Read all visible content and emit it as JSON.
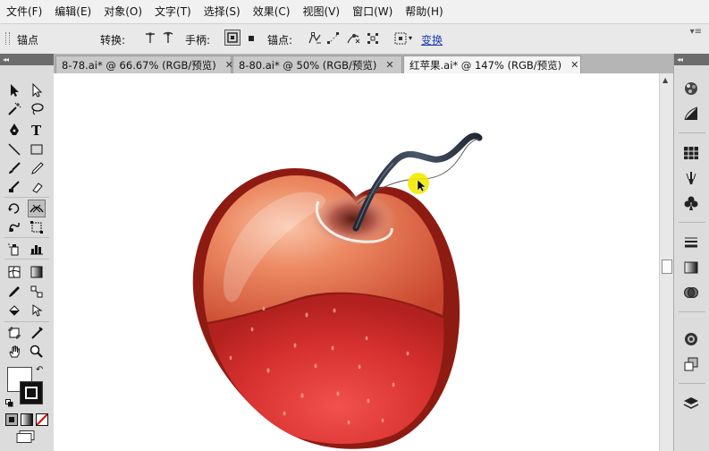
{
  "menu": [
    "文件(F)",
    "编辑(E)",
    "对象(O)",
    "文字(T)",
    "选择(S)",
    "效果(C)",
    "视图(V)",
    "窗口(W)",
    "帮助(H)"
  ],
  "control_bar": {
    "mode_label": "锚点",
    "convert_label": "转换:",
    "handles_label": "手柄:",
    "anchors_label": "锚点:",
    "transform_link": "变换"
  },
  "tabs": [
    {
      "label": "8-78.ai* @ 66.67% (RGB/预览)",
      "active": false
    },
    {
      "label": "8-80.ai* @ 50% (RGB/预览)",
      "active": false
    },
    {
      "label": "红苹果.ai* @ 147% (RGB/预览)",
      "active": true
    }
  ],
  "colors": {
    "apple_dark_outline": "#8e1b12",
    "apple_upper": "#e0673f",
    "apple_lower": "#d5302f",
    "stem": "#263040",
    "cursor_highlight": "#f2ea00"
  }
}
